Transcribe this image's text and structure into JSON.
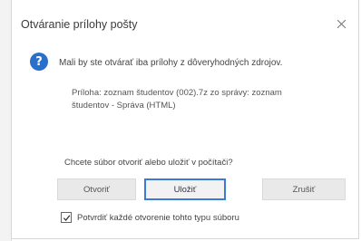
{
  "dialog": {
    "title": "Otváranie prílohy pošty",
    "message": "Mali by ste otvárať iba prílohy z dôveryhodných zdrojov.",
    "detail": "Príloha: zoznam študentov (002).7z zo správy: zoznam študentov - Správa (HTML)",
    "question": "Chcete súbor otvoriť alebo uložiť v počítači?",
    "buttons": {
      "open": "Otvoriť",
      "save": "Uložiť",
      "cancel": "Zrušiť"
    },
    "checkbox": {
      "label": "Potvrdiť každé otvorenie tohto typu súboru",
      "checked": true
    },
    "icons": {
      "info": "info-icon",
      "close": "close-icon",
      "check": "check-icon"
    },
    "accent_color": "#2a6fc9",
    "focus_color": "#3b7ad9"
  }
}
